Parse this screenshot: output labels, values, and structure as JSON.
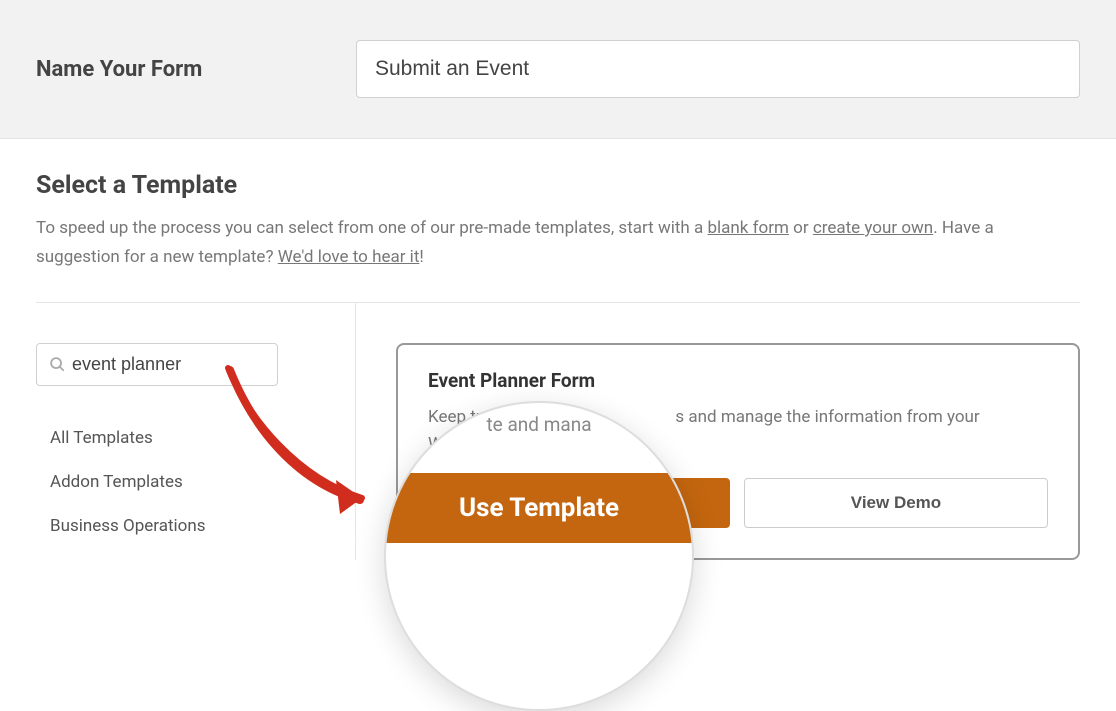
{
  "header": {
    "label": "Name Your Form",
    "input_value": "Submit an Event"
  },
  "template_section": {
    "title": "Select a Template",
    "desc_pre": "To speed up the process you can select from one of our pre-made templates, start with a ",
    "link_blank": "blank form",
    "desc_mid": " or ",
    "link_create": "create your own",
    "desc_post": ". Have a suggestion for a new template? ",
    "link_hear": "We'd love to hear it",
    "desc_end": "!"
  },
  "search": {
    "value": "event planner"
  },
  "categories": [
    "All Templates",
    "Addon Templates",
    "Business Operations"
  ],
  "card": {
    "title": "Event Planner Form",
    "desc_part1": "Keep track of ",
    "desc_part2": "s and manage the information from your WordPress admin a",
    "btn_use": "Use Template",
    "btn_demo": "View Demo"
  },
  "magnifier": {
    "snippet_top": "te and mana",
    "btn_text": "Use Template"
  }
}
